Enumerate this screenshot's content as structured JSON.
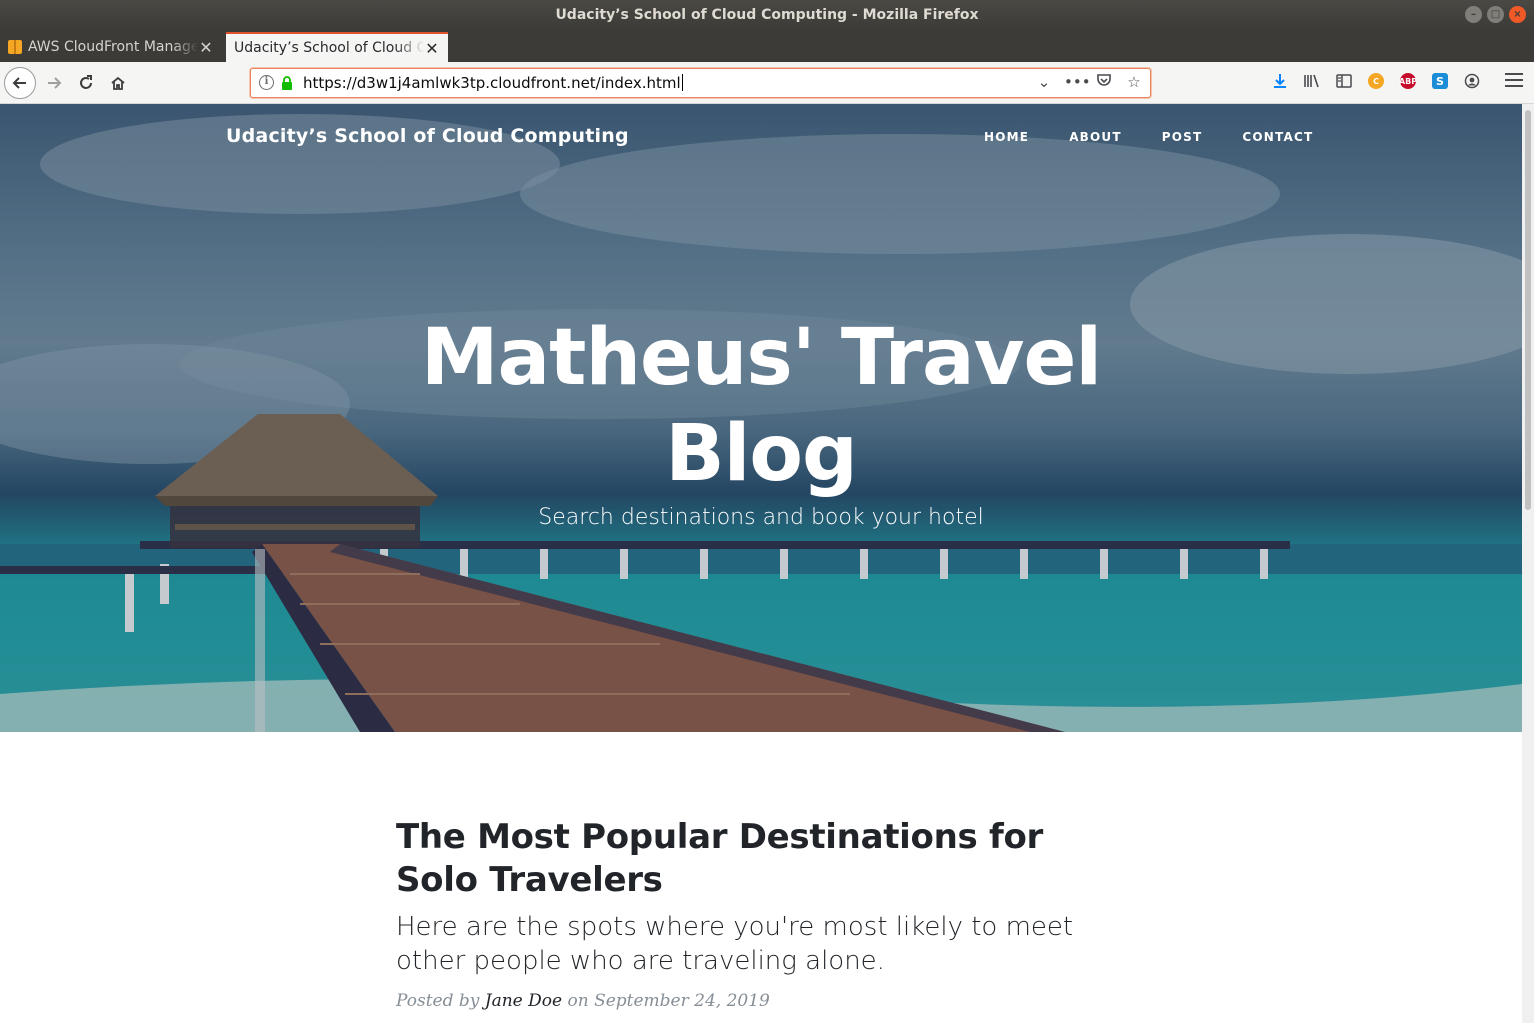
{
  "window": {
    "title": "Udacity’s School of Cloud Computing - Mozilla Firefox"
  },
  "tabs": [
    {
      "label": "AWS CloudFront Management Console",
      "active": false,
      "icon": "aws-cube-icon"
    },
    {
      "label": "Udacity’s School of Cloud Computing",
      "active": true,
      "icon": ""
    }
  ],
  "toolbar": {
    "url": "https://d3w1j4amlwk3tp.cloudfront.net/index.html",
    "accent": "#e0522a"
  },
  "site": {
    "brand": "Udacity’s School of Cloud Computing",
    "nav": [
      "HOME",
      "ABOUT",
      "POST",
      "CONTACT"
    ],
    "hero_title": "Matheus' Travel Blog",
    "hero_subtitle": "Search destinations and book your hotel"
  },
  "post": {
    "title": "The Most Popular Destinations for Solo Travelers",
    "subtitle": "Here are the spots where you're most likely to meet other people who are traveling alone.",
    "meta_prefix": "Posted by",
    "author": "Jane Doe",
    "meta_on": "on",
    "date": "September 24, 2019"
  }
}
